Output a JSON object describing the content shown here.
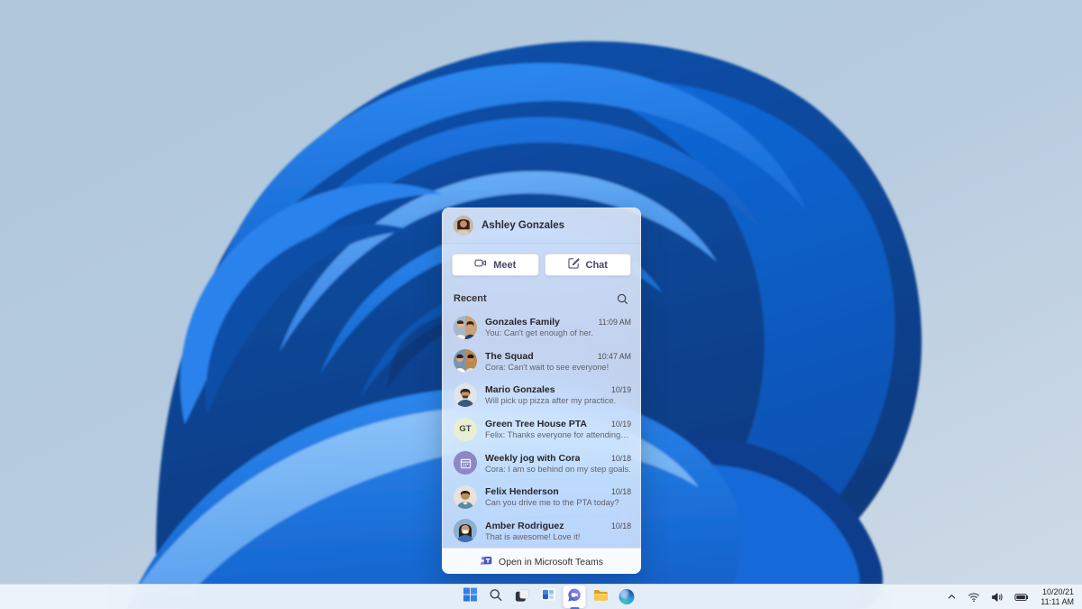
{
  "flyout": {
    "header": {
      "name": "Ashley Gonzales"
    },
    "actions": {
      "meet_label": "Meet",
      "chat_label": "Chat"
    },
    "recent_label": "Recent",
    "items": [
      {
        "name": "Gonzales Family",
        "preview": "You: Can't get enough of her.",
        "time": "11:09 AM",
        "avatar": "group-photo"
      },
      {
        "name": "The Squad",
        "preview": "Cora: Can't wait to see everyone!",
        "time": "10:47 AM",
        "avatar": "group-photo"
      },
      {
        "name": "Mario Gonzales",
        "preview": "Will pick up pizza after my practice.",
        "time": "10/19",
        "avatar": "photo"
      },
      {
        "name": "Green Tree House PTA",
        "preview": "Felix: Thanks everyone for attending today.",
        "time": "10/19",
        "avatar": "initials",
        "initials": "GT"
      },
      {
        "name": "Weekly jog with Cora",
        "preview": "Cora: I am so behind on my step goals.",
        "time": "10/18",
        "avatar": "calendar-icon"
      },
      {
        "name": "Felix Henderson",
        "preview": "Can you drive me to the PTA today?",
        "time": "10/18",
        "avatar": "photo"
      },
      {
        "name": "Amber Rodriguez",
        "preview": "That is awesome! Love it!",
        "time": "10/18",
        "avatar": "photo"
      }
    ],
    "footer": {
      "label": "Open in Microsoft Teams"
    }
  },
  "taskbar": {
    "icons": [
      "start",
      "search",
      "task-view",
      "widgets",
      "chat",
      "file-explorer",
      "edge"
    ],
    "active_app": "chat",
    "tray_icons": [
      "hidden-icons-chevron",
      "network",
      "volume",
      "battery"
    ],
    "clock": {
      "date": "10/20/21",
      "time": "11:11 AM"
    }
  },
  "colors": {
    "teams_purple": "#5b5fc7",
    "accent_blue": "#2e7fe5",
    "taskbar_bg": "#eef4fb",
    "flyout_text": "#26262c",
    "run_indicator": "#4576d9"
  }
}
